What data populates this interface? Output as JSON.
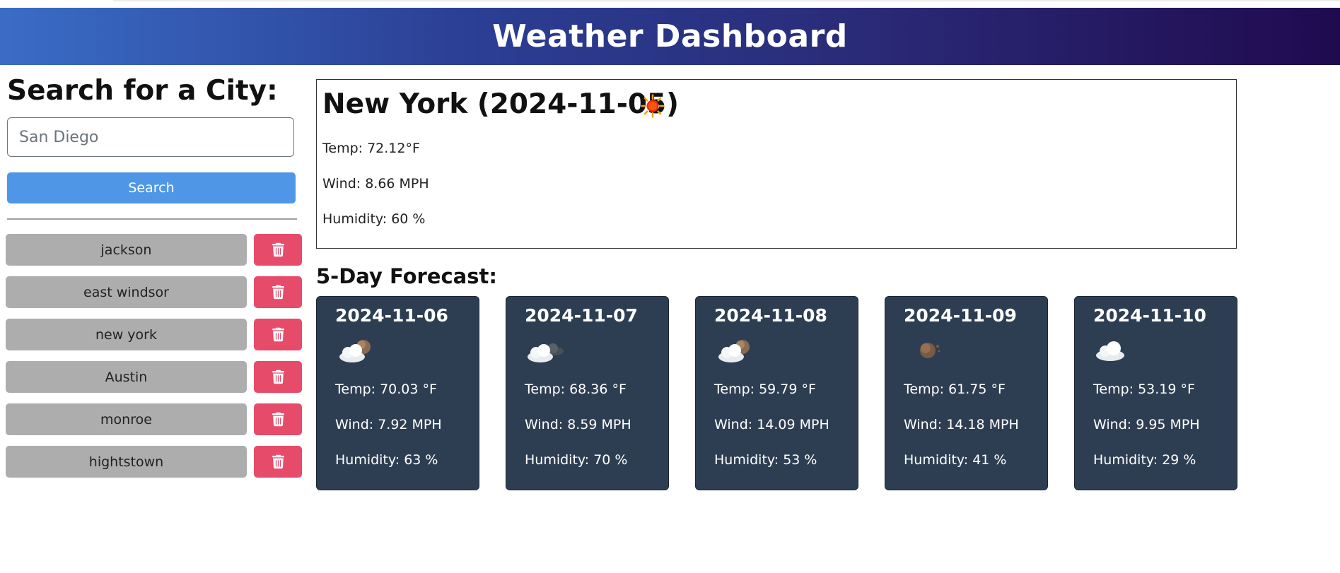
{
  "header": {
    "title": "Weather Dashboard"
  },
  "sidebar": {
    "heading": "Search for a City:",
    "search_value": "San Diego",
    "search_button": "Search",
    "history": [
      {
        "label": "jackson"
      },
      {
        "label": "east windsor"
      },
      {
        "label": "new york"
      },
      {
        "label": "Austin"
      },
      {
        "label": "monroe"
      },
      {
        "label": "hightstown"
      }
    ],
    "delete_icon": "trash-icon"
  },
  "current": {
    "title": "New York (2024-11-05)",
    "icon": "sun-icon",
    "temp": "Temp: 72.12°F",
    "wind": "Wind: 8.66 MPH",
    "humidity": "Humidity: 60 %"
  },
  "forecast": {
    "title": "5-Day Forecast:",
    "days": [
      {
        "date": "2024-11-06",
        "icon": "cloud-with-moon-icon",
        "temp": "Temp: 70.03 °F",
        "wind": "Wind: 7.92 MPH",
        "humidity": "Humidity: 63 %"
      },
      {
        "date": "2024-11-07",
        "icon": "broken-clouds-icon",
        "temp": "Temp: 68.36 °F",
        "wind": "Wind: 8.59 MPH",
        "humidity": "Humidity: 70 %"
      },
      {
        "date": "2024-11-08",
        "icon": "cloud-with-moon-icon",
        "temp": "Temp: 59.79 °F",
        "wind": "Wind: 14.09 MPH",
        "humidity": "Humidity: 53 %"
      },
      {
        "date": "2024-11-09",
        "icon": "moon-icon",
        "temp": "Temp: 61.75 °F",
        "wind": "Wind: 14.18 MPH",
        "humidity": "Humidity: 41 %"
      },
      {
        "date": "2024-11-10",
        "icon": "cloud-icon",
        "temp": "Temp: 53.19 °F",
        "wind": "Wind: 9.95 MPH",
        "humidity": "Humidity: 29 %"
      }
    ]
  },
  "colors": {
    "header_start": "#3a6cc6",
    "header_end": "#200a4f",
    "search_button": "#4f97e6",
    "history_button": "#adadad",
    "delete_button": "#e74b6a",
    "card_background": "#2e3e52"
  }
}
